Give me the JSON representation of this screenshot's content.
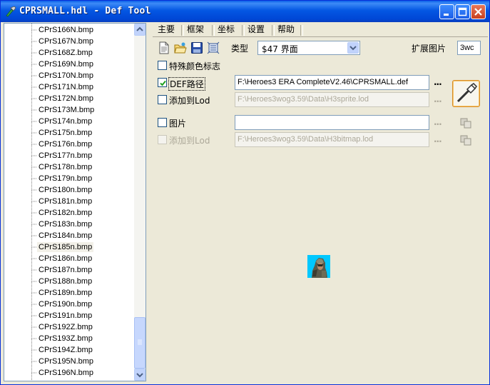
{
  "window": {
    "title": "CPRSMALL.hdl - Def Tool",
    "buttons": [
      "minimize",
      "maximize",
      "close"
    ]
  },
  "tree": {
    "items": [
      {
        "label": "CPrS166N.bmp"
      },
      {
        "label": "CPrS167N.bmp"
      },
      {
        "label": "CPrS168Z.bmp"
      },
      {
        "label": "CPrS169N.bmp"
      },
      {
        "label": "CPrS170N.bmp"
      },
      {
        "label": "CPrS171N.bmp"
      },
      {
        "label": "CPrS172N.bmp"
      },
      {
        "label": "CPrS173M.bmp"
      },
      {
        "label": "CPrS174n.bmp"
      },
      {
        "label": "CPrS175n.bmp"
      },
      {
        "label": "CPrS176n.bmp"
      },
      {
        "label": "CPrS177n.bmp"
      },
      {
        "label": "CPrS178n.bmp"
      },
      {
        "label": "CPrS179n.bmp"
      },
      {
        "label": "CPrS180n.bmp"
      },
      {
        "label": "CPrS181n.bmp"
      },
      {
        "label": "CPrS182n.bmp"
      },
      {
        "label": "CPrS183n.bmp"
      },
      {
        "label": "CPrS184n.bmp"
      },
      {
        "label": "CPrS185n.bmp",
        "selected": true
      },
      {
        "label": "CPrS186n.bmp"
      },
      {
        "label": "CPrS187n.bmp"
      },
      {
        "label": "CPrS188n.bmp"
      },
      {
        "label": "CPrS189n.bmp"
      },
      {
        "label": "CPrS190n.bmp"
      },
      {
        "label": "CPrS191n.bmp"
      },
      {
        "label": "CPrS192Z.bmp"
      },
      {
        "label": "CPrS193Z.bmp"
      },
      {
        "label": "CPrS194Z.bmp"
      },
      {
        "label": "CPrS195N.bmp"
      },
      {
        "label": "CPrS196N.bmp"
      }
    ]
  },
  "tabs": [
    {
      "label": "主要",
      "active": true
    },
    {
      "label": "框架"
    },
    {
      "label": "坐标"
    },
    {
      "label": "设置"
    },
    {
      "label": "帮助"
    }
  ],
  "toolbar": {
    "icons": [
      "new-file-icon",
      "open-folder-icon",
      "save-icon",
      "export-icon"
    ],
    "type_label": "类型",
    "type_value": "$47 界面",
    "ext_image_label": "扩展图片",
    "ext_image_value": "3wc"
  },
  "options": {
    "special_color_flag": {
      "label": "特殊颜色标志",
      "checked": false
    },
    "def_path": {
      "label": "DEF路径",
      "checked": true,
      "value": "F:\\Heroes3 ERA CompleteV2.46\\CPRSMALL.def"
    },
    "def_add_to_lod": {
      "label": "添加到Lod",
      "checked": false,
      "value": "F:\\Heroes3wog3.59\\Data\\H3sprite.lod"
    },
    "picture": {
      "label": "图片",
      "checked": false,
      "value": ""
    },
    "picture_add_to_lod": {
      "label": "添加到Lod",
      "checked": false,
      "disabled": true,
      "value": "F:\\Heroes3wog3.59\\Data\\H3bitmap.lod"
    },
    "ellipsis": "..."
  },
  "colors": {
    "titlebar": "#0054e3",
    "face": "#ece9d8",
    "field_border": "#7f9db9",
    "disabled_text": "#aca899"
  }
}
